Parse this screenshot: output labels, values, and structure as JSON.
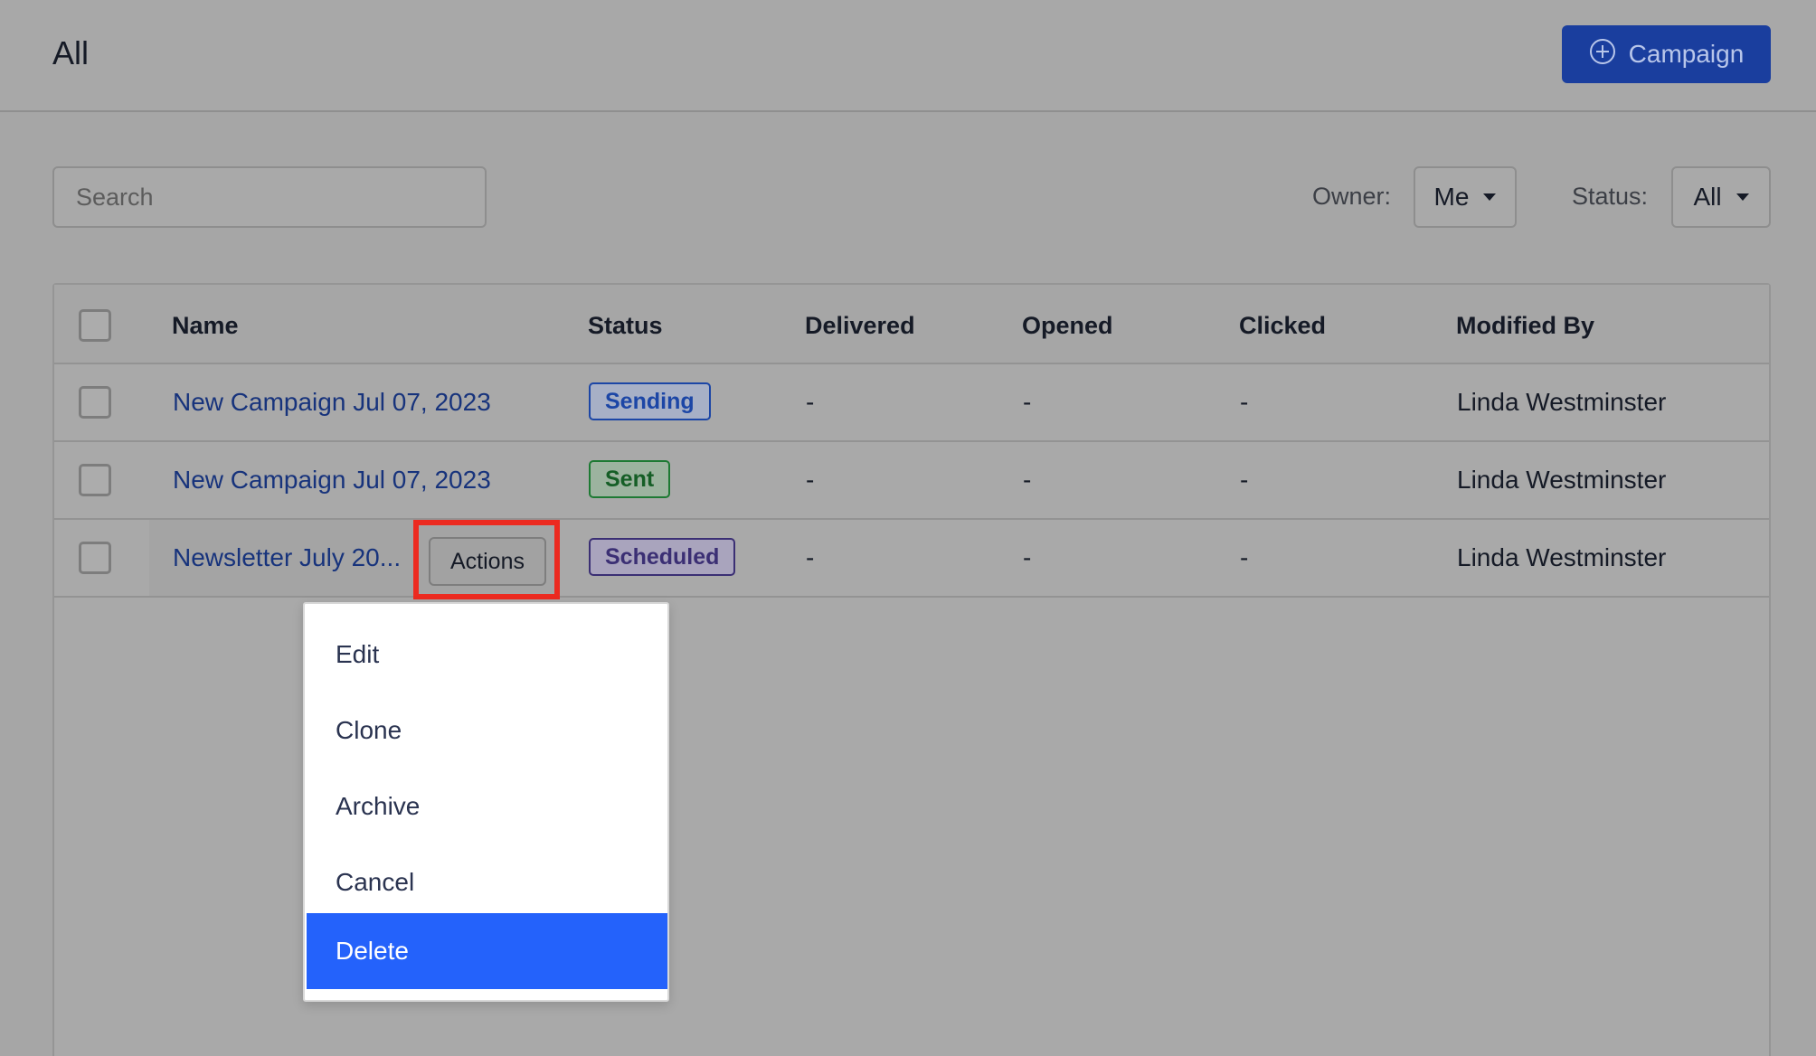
{
  "header": {
    "title": "All",
    "new_button_label": "Campaign",
    "new_button_icon": "plus-circle-icon"
  },
  "filters": {
    "search_placeholder": "Search",
    "owner_label": "Owner:",
    "owner_value": "Me",
    "status_label": "Status:",
    "status_value": "All"
  },
  "table": {
    "columns": [
      "Name",
      "Status",
      "Delivered",
      "Opened",
      "Clicked",
      "Modified By"
    ],
    "rows": [
      {
        "name": "New Campaign Jul 07, 2023",
        "status": "Sending",
        "delivered": "-",
        "opened": "-",
        "clicked": "-",
        "modified_by": "Linda Westminster"
      },
      {
        "name": "New Campaign Jul 07, 2023",
        "status": "Sent",
        "delivered": "-",
        "opened": "-",
        "clicked": "-",
        "modified_by": "Linda Westminster"
      },
      {
        "name": "Newsletter July 20...",
        "status": "Scheduled",
        "delivered": "-",
        "opened": "-",
        "clicked": "-",
        "modified_by": "Linda Westminster"
      }
    ],
    "row_actions_label": "Actions"
  },
  "actions_menu": {
    "items": [
      "Edit",
      "Clone",
      "Archive",
      "Cancel",
      "Delete"
    ],
    "highlighted": "Delete"
  },
  "colors": {
    "primary": "#1a3e9e",
    "highlight_box": "#ec2a20",
    "menu_active": "#2462fb",
    "sending": "#1c46a6",
    "sent": "#1d7a33",
    "scheduled": "#3b2f74"
  }
}
